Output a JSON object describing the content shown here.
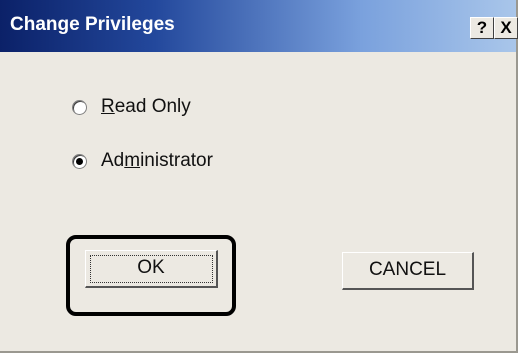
{
  "dialog": {
    "title": "Change Privileges",
    "help_label": "?",
    "close_label": "X"
  },
  "options": [
    {
      "label_pre": "",
      "label_ul": "R",
      "label_post": "ead Only",
      "selected": false
    },
    {
      "label_pre": "Ad",
      "label_ul": "m",
      "label_post": "inistrator",
      "selected": true
    }
  ],
  "buttons": {
    "ok_label": "OK",
    "cancel_label": "CANCEL"
  }
}
